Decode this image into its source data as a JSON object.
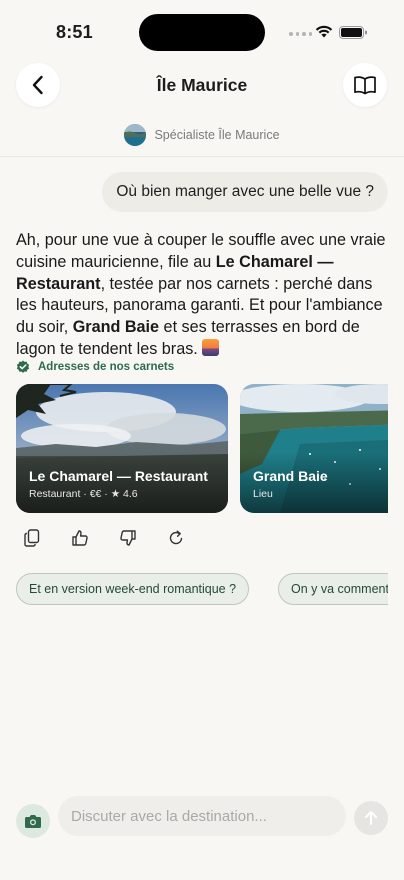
{
  "status_bar": {
    "time": "8:51"
  },
  "header": {
    "title": "Île Maurice",
    "back_icon": "chevron-left-icon",
    "guide_icon": "open-book-icon"
  },
  "specialist": {
    "label": "Spécialiste Île Maurice"
  },
  "conversation": {
    "user_message": "Où bien manger avec une belle vue ?",
    "assistant": {
      "part1": "Ah, pour une vue à couper le souffle avec une vraie cuisine mauricienne, file au ",
      "bold1": "Le Chamarel — Restaurant",
      "part2": ", testée par nos carnets : perché dans les hauteurs, panorama garanti. Et pour l'ambiance du soir, ",
      "bold2": "Grand Baie",
      "part3": " et ses terrasses en bord de lagon te tendent les bras. ",
      "emoji": "sunset-emoji"
    },
    "verified_label": "Adresses de nos carnets",
    "cards": [
      {
        "title": "Le Chamarel — Restaurant",
        "subtitle": "Restaurant · €€ · ★ 4.6"
      },
      {
        "title": "Grand Baie",
        "subtitle": "Lieu"
      }
    ],
    "actions": [
      "copy-icon",
      "thumbs-up-icon",
      "thumbs-down-icon",
      "refresh-icon"
    ],
    "suggestions": [
      "Et en version week-end romantique ?",
      "On y va comment ?"
    ]
  },
  "composer": {
    "placeholder": "Discuter avec la destination...",
    "camera_icon": "camera-icon",
    "send_icon": "arrow-up-icon"
  },
  "colors": {
    "background": "#f8f7f3",
    "accent_green": "#2f6b4b",
    "chip_bg": "#e9eee9"
  }
}
